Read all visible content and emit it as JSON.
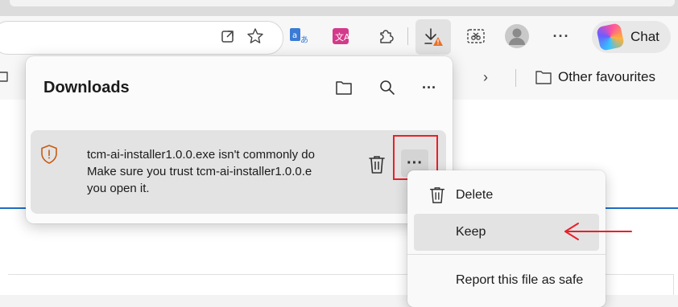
{
  "toolbar": {
    "icons": [
      "open-in-app-icon",
      "favorite-star-icon",
      "translate-icon",
      "translate-ai-icon",
      "extensions-icon",
      "downloads-icon",
      "screenshot-icon",
      "profile-avatar",
      "more-icon"
    ],
    "more_label": "···",
    "chat_label": "Chat"
  },
  "favbar": {
    "other_favourites": "Other favourites",
    "chevron": "›"
  },
  "downloads": {
    "title": "Downloads",
    "item": {
      "line1": "tcm-ai-installer1.0.0.exe isn't commonly do",
      "line2": "Make sure you trust tcm-ai-installer1.0.0.e",
      "line3": "you open it.",
      "more_label": "···"
    },
    "header_more_label": "···"
  },
  "context_menu": {
    "items": [
      "Delete",
      "Keep",
      "Report this file as safe"
    ]
  },
  "colors": {
    "highlight_red": "#e8202a",
    "warning_orange": "#c95a12",
    "link_blue": "#1f6fc4"
  }
}
